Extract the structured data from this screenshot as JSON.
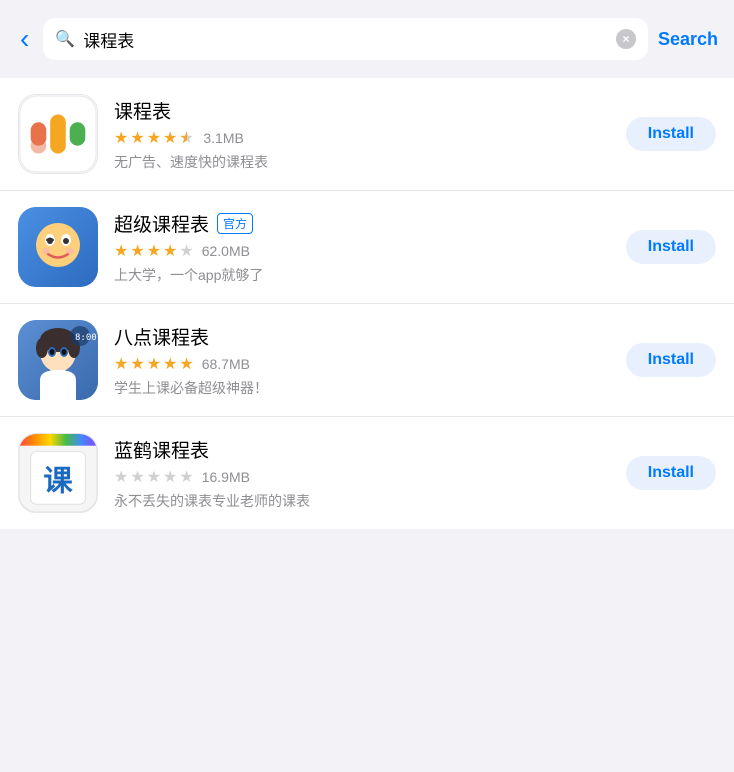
{
  "header": {
    "back_label": "‹",
    "search_value": "课程表",
    "clear_icon": "×",
    "search_button": "Search"
  },
  "apps": [
    {
      "id": "app1",
      "name": "课程表",
      "official": false,
      "stars_full": 4,
      "stars_half": 1,
      "stars_empty": 0,
      "rating_display": "4.5",
      "file_size": "3.1MB",
      "description": "无广告、速度快的课程表",
      "install_label": "Install",
      "icon_type": "kechengbiao"
    },
    {
      "id": "app2",
      "name": "超级课程表",
      "official": true,
      "official_text": "官方",
      "stars_full": 4,
      "stars_half": 0,
      "stars_empty": 1,
      "rating_display": "4.0",
      "file_size": "62.0MB",
      "description": "上大学，一个app就够了",
      "install_label": "Install",
      "icon_type": "super"
    },
    {
      "id": "app3",
      "name": "八点课程表",
      "official": false,
      "stars_full": 5,
      "stars_half": 0,
      "stars_empty": 0,
      "rating_display": "5.0",
      "file_size": "68.7MB",
      "description": "学生上课必备超级神器！",
      "install_label": "Install",
      "icon_type": "baodian"
    },
    {
      "id": "app4",
      "name": "蓝鹤课程表",
      "official": false,
      "stars_full": 0,
      "stars_half": 0,
      "stars_empty": 5,
      "rating_display": "0.0",
      "file_size": "16.9MB",
      "description": "永不丢失的课表专业老师的课表",
      "install_label": "Install",
      "icon_type": "lanhe"
    }
  ]
}
